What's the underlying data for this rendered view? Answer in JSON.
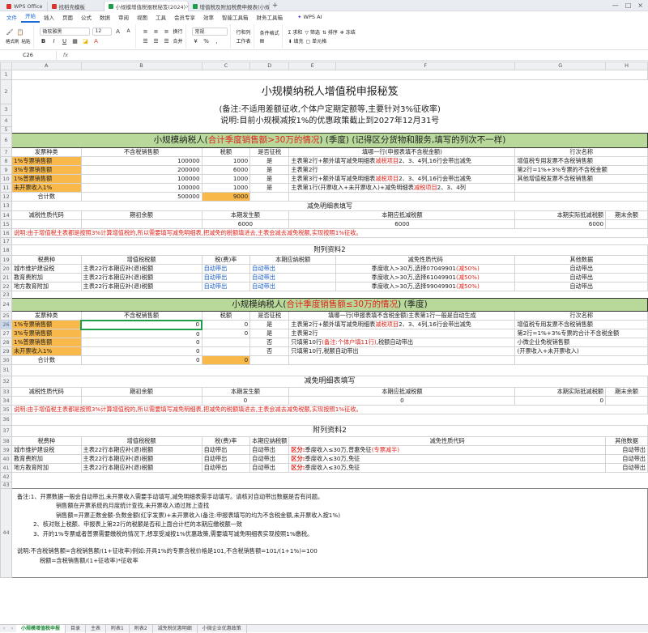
{
  "window": {
    "tabs": [
      {
        "label": "WPS Office",
        "color": "#d8372b"
      },
      {
        "label": "找稻壳模板",
        "color": "#d8372b"
      },
      {
        "label": "小规模增值税报税秘笈(2024)",
        "color": "#1e9e49"
      },
      {
        "label": "增值税及附加税费申报表(小规模纳税人适用)",
        "color": "#1e9e49"
      }
    ],
    "active_tab": 2
  },
  "menu": [
    "文件",
    "开始",
    "插入",
    "页面",
    "公式",
    "数据",
    "审阅",
    "视图",
    "工具",
    "会员专享",
    "效率",
    "智能工具箱",
    "财务工具箱"
  ],
  "menu_active": 1,
  "wps_ai": "WPS AI",
  "ribbon": {
    "format_painter": "格式刷",
    "paste": "粘贴",
    "font_name": "微软雅黑",
    "font_size": "12",
    "wrap": "换行",
    "merge": "合并",
    "number_format": "常规",
    "row_col": "行和列",
    "worksheet": "工作表",
    "cond_format": "条件格式",
    "sum": "求和",
    "filter": "筛选",
    "sort": "排序",
    "fill": "填充",
    "cell": "单元格",
    "freeze": "冻结"
  },
  "formula_bar": {
    "cell_ref": "C26",
    "fx": "fx"
  },
  "columns": [
    "A",
    "B",
    "C",
    "D",
    "E",
    "F",
    "G",
    "H"
  ],
  "sheet": {
    "title": "小规模纳税人增值税申报秘笈",
    "note1": "(备注:不适用差额征收,个体户定期定额等,主要针对3%征收率)",
    "note2": "说明:目前小规模减按1%的优惠政策截止到2027年12月31号",
    "sec1_header": {
      "p1": "小规模纳税人(",
      "p2": "合计季度销售额>30万的情况",
      "p3": ")  (季度)  (记得区分货物和服务,填写的列次不一样)"
    },
    "sec1_cols": [
      "发票种类",
      "不含税销售额",
      "税额",
      "是否征税",
      "填哪一行(申报表填不含税金额)",
      "行次名称"
    ],
    "sec1_rows": [
      {
        "type": "1%专票销售额",
        "amount": "100000",
        "tax": "1000",
        "taxed": "是",
        "fill_a": "主表第2行+额外填写减免明细表",
        "fill_b": "减税项目",
        "fill_c": "2、3、4列,16行会带出减免",
        "name": "增值税专用发票不含税销售额"
      },
      {
        "type": "3%专票销售额",
        "amount": "200000",
        "tax": "6000",
        "taxed": "是",
        "fill_a": "主表第2行",
        "fill_b": "",
        "fill_c": "",
        "name": "第2行=1%+3%专票的不含税金额"
      },
      {
        "type": "1%普票销售额",
        "amount": "100000",
        "tax": "1000",
        "taxed": "是",
        "fill_a": "主表第3行+额外填写减免明细表",
        "fill_b": "减税项目",
        "fill_c": "2、3、4列,16行会带出减免",
        "name": "其他增值税发票不含税销售额"
      },
      {
        "type": "未开票收入1%",
        "amount": "100000",
        "tax": "1000",
        "taxed": "是",
        "fill_a": "主表第1行(开票收入+未开票收入)+减免明细表",
        "fill_b": "减税项目",
        "fill_c": "2、3、4列",
        "name": ""
      }
    ],
    "sec1_total": {
      "label": "合计数",
      "amount": "500000",
      "tax": "9000"
    },
    "relief_title": "减免明细表填写",
    "relief_cols": [
      "减税性质代码",
      "期初余额",
      "本期发生额",
      "本期应抵减税额",
      "本期实际抵减税额",
      "期末余额"
    ],
    "relief_values1": [
      "",
      "",
      "6000",
      "6000",
      "6000",
      ""
    ],
    "relief_note": "说明:由于增值税主表都是按照3%计算增值税的,所以需要填写减免明细表,把减免的税额填进去,主表会减去减免税额,实现按照1%征收。",
    "appendix_title": "附列资料2",
    "appendix_cols": [
      "税费种",
      "增值税税额",
      "税(费)率",
      "本期应纳税额",
      "减免性质代码",
      "其他数据"
    ],
    "appendix1_rows": [
      {
        "kind": "城市维护建设税",
        "base": "主表22行本期应补(退)税额",
        "rate": "自动带出",
        "due": "自动带出",
        "code_a": "季度收入>30万,选择07049901",
        "code_b": "(减50%)",
        "other": "自动带出"
      },
      {
        "kind": "教育费附加",
        "base": "主表22行本期应补(退)税额",
        "rate": "自动带出",
        "due": "自动带出",
        "code_a": "季度收入>30万,选择61049901",
        "code_b": "(减50%)",
        "other": "自动带出"
      },
      {
        "kind": "地方教育附加",
        "base": "主表22行本期应补(退)税额",
        "rate": "自动带出",
        "due": "自动带出",
        "code_a": "季度收入>30万,选择99049901",
        "code_b": "(减50%)",
        "other": "自动带出"
      }
    ],
    "sec2_header": {
      "p1": "小规模纳税人(",
      "p2": "合计季度销售额≤30万的情况",
      "p3": ")  (季度)"
    },
    "sec2_cols": [
      "发票种类",
      "不含税销售额",
      "税额",
      "是否征税",
      "填哪一行(申报表填不含税金额)",
      "行次名称"
    ],
    "sec2_rows": [
      {
        "type": "1%专票销售额",
        "amount": "0",
        "tax": "0",
        "taxed": "是",
        "fill_a": "主表第2行+额外填写减免明细表",
        "fill_b": "减税项目",
        "fill_c": "2、3、4列,16行会带出减免",
        "name": "增值税专用发票不含税销售额"
      },
      {
        "type": "3%专票销售额",
        "amount": "0",
        "tax": "0",
        "taxed": "是",
        "fill_a": "主表第2行",
        "fill_b": "",
        "fill_c": "",
        "name": "第2行=1%+3%专票的合计不含税金额"
      },
      {
        "type": "1%普票销售额",
        "amount": "0",
        "tax": "",
        "taxed": "否",
        "fill_a": "只填第10行",
        "fill_b": "(备注:个体户填11行)",
        "fill_c": ",税额自动带出",
        "name": "小微企业免税销售额"
      },
      {
        "type": "未开票收入1%",
        "amount": "0",
        "tax": "",
        "taxed": "否",
        "fill_a": "只填第10行,税额自动带出",
        "fill_b": "",
        "fill_c": "",
        "name": "(开票收入+未开票收入)"
      }
    ],
    "sec2_total": {
      "label": "合计数",
      "amount": "0",
      "tax": "0"
    },
    "sec2_fill_header_note": "主表第1行一般是自动生成",
    "relief_values2": [
      "",
      "",
      "0",
      "0",
      "0",
      ""
    ],
    "appendix2_rows": [
      {
        "kind": "城市维护建设税",
        "base": "主表22行本期应补(退)税额",
        "rate": "自动带出",
        "due": "自动带出",
        "code_label": "区分:",
        "code_a": "季度收入≤30万,普惠免征",
        "code_b": "(专票减半)",
        "other": "自动带出"
      },
      {
        "kind": "教育费附加",
        "base": "主表22行本期应补(退)税额",
        "rate": "自动带出",
        "due": "自动带出",
        "code_label": "区分:",
        "code_a": "季度收入≤30万,免征",
        "code_b": "",
        "other": "自动带出"
      },
      {
        "kind": "地方教育附加",
        "base": "主表22行本期应补(退)税额",
        "rate": "自动带出",
        "due": "自动带出",
        "code_label": "区分:",
        "code_a": "季度收入≤30万,免征",
        "code_b": "",
        "other": "自动带出"
      }
    ],
    "remarks": [
      "备注:1、开票数据一般会自动带出,未开票收入需要手动填写,减免明细表需手动填写。请核对自动带出数据是否有问题。",
      "销售额在开票系统的月度统计查找,未开票收入通过账上查找",
      "销售额=开票正数金额-负数金额(红字发票)+未开票收入(备注:申报表填写的均为不含税金额,未开票收入按1%)",
      "2、核对账上税额、申报表上第22行的税额是否和上面合计栏的本期应缴税额一致",
      "3、开的1%专票或者普票需要缴税的情况下,想享受减按1%优惠政策,需要填写减免明细表实现按照1%缴税。",
      "说明:不含税销售额=含税销售额/(1+征收率)例如:开具1%的专票含税价格是101,不含税销售额=101/(1+1%)=100",
      "税额=含税销售额/(1+征收率)*征收率"
    ]
  },
  "sheet_tabs": [
    "小规模增值税申报",
    "目录",
    "主表",
    "附表1",
    "附表2",
    "减免税优惠明细",
    "小微企业优惠政策"
  ],
  "sheet_tab_active": 0,
  "colors": {
    "section_green": "#b8d99a",
    "highlight_orange": "#f8b84a",
    "alert_red": "#e0231b",
    "link_blue": "#1a5fc9"
  }
}
